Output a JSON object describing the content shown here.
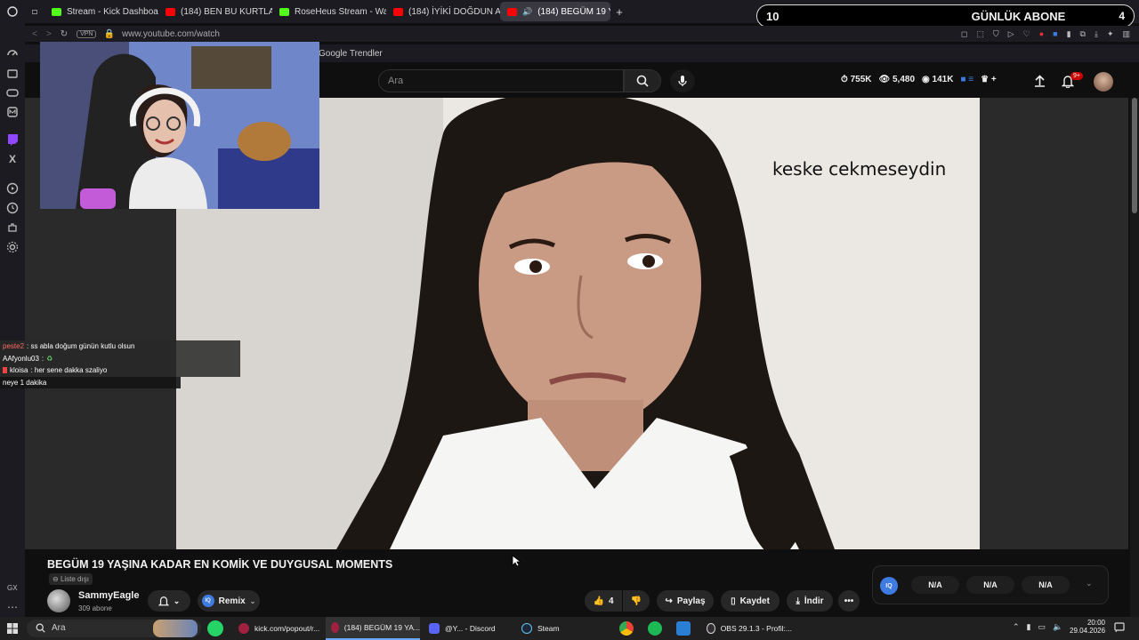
{
  "browser": {
    "tabs": [
      {
        "label": "Stream - Kick Dashboard",
        "color": "#53fc18"
      },
      {
        "label": "(184) BEN BU KURTLAR S",
        "color": "#ff0000"
      },
      {
        "label": "RoseHeus Stream - Watch",
        "color": "#53fc18"
      },
      {
        "label": "(184) İYİKİ DOĞDUN ABLA",
        "color": "#ff0000"
      },
      {
        "label": "(184) BEGÜM 19 YAŞIN",
        "color": "#ff0000",
        "active": true
      }
    ],
    "new_tab": "+",
    "url": "www.youtube.com/watch",
    "vpn_label": "VPN",
    "bookmark": "Google Trendler"
  },
  "overlay": {
    "goal_label": "GÜNLÜK ABONE",
    "goal_value": "10",
    "goal_icon": "4",
    "chat": [
      {
        "user": "peste2",
        "text": ": ss abla doğum günün kutlu olsun",
        "user_color": "#ff6a6a"
      },
      {
        "user": "AAfyonlu03",
        "text": ":",
        "user_color": "#ffffff"
      },
      {
        "user": "kloisa",
        "text": ": her sene dakka szaliyo",
        "user_color": "#ffffff"
      },
      {
        "user": "",
        "text": "neye 1 dakika",
        "user_color": "#ffffff"
      }
    ]
  },
  "youtube": {
    "search_placeholder": "Ara",
    "stats": [
      "755K",
      "5,480",
      "141K"
    ],
    "notif_count": "9+",
    "video_caption": "keske cekmeseydin",
    "title": "BEGÜM 19 YAŞINA KADAR EN KOMİK VE DUYGUSAL MOMENTS",
    "playlist_tag": "Liste dışı",
    "channel": "SammyEagle",
    "subs": "309 abone",
    "remix": "Remix",
    "likes": "4",
    "share": "Paylaş",
    "save": "Kaydet",
    "download": "İndir",
    "ext_values": [
      "N/A",
      "N/A",
      "N/A"
    ],
    "ext_badge": "IQ"
  },
  "taskbar": {
    "search": "Ara",
    "items": [
      "kick.com/popout/r...",
      "(184) BEGÜM 19 YA...",
      "@Y... - Discord",
      "Steam",
      "OBS 29.1.3 - Profil:..."
    ],
    "time": "20:00",
    "date": "29.04.2026"
  },
  "side_labels": {
    "gx": "GX"
  },
  "colors": {
    "youtube_red": "#ff0000",
    "kick_green": "#53fc18",
    "accent_blue": "#3d7be0"
  }
}
